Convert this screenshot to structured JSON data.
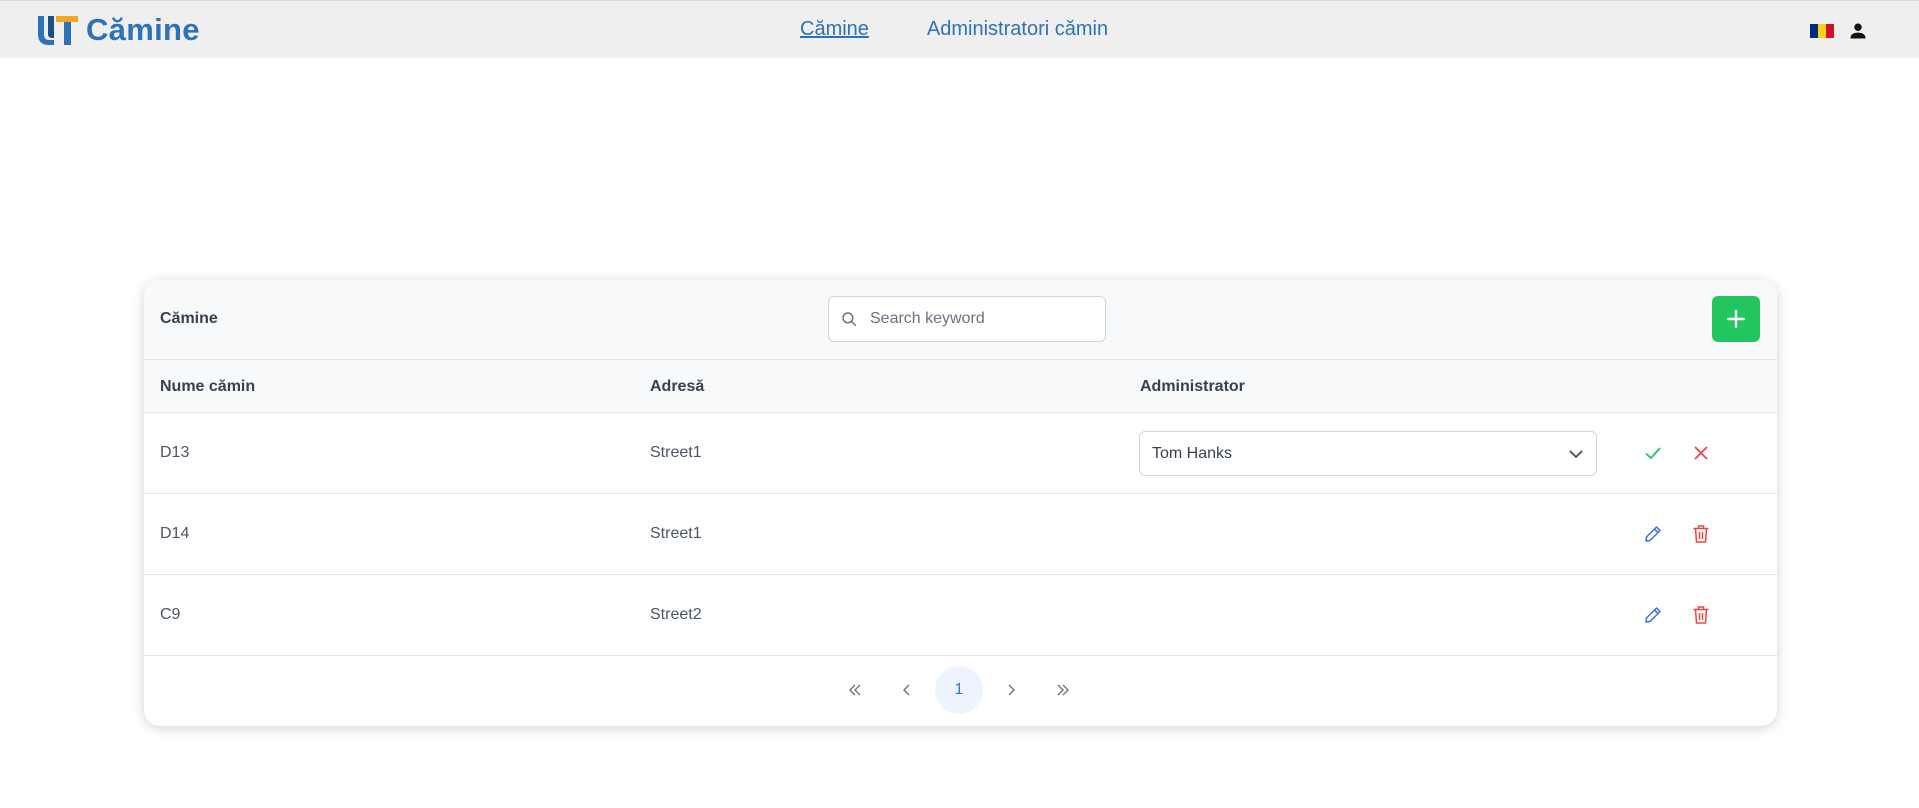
{
  "header": {
    "app_title": "Cămine",
    "nav": [
      {
        "label": "Cămine",
        "active": true
      },
      {
        "label": "Administratori cămin",
        "active": false
      }
    ],
    "flag_colors": [
      "#002b7f",
      "#fcd116",
      "#ce1126"
    ]
  },
  "card": {
    "title": "Cămine",
    "search_placeholder": "Search keyword",
    "add_icon": "plus-icon",
    "columns": [
      "Nume cămin",
      "Adresă",
      "Administrator"
    ],
    "rows": [
      {
        "name": "D13",
        "address": "Street1",
        "administrator": "Tom Hanks",
        "editing": true
      },
      {
        "name": "D14",
        "address": "Street1",
        "administrator": "",
        "editing": false
      },
      {
        "name": "C9",
        "address": "Street2",
        "administrator": "",
        "editing": false
      }
    ],
    "pagination": {
      "current_page": "1"
    }
  },
  "colors": {
    "brand": "#2d72b8",
    "add_button": "#22c55e",
    "confirm": "#22c55e",
    "cancel": "#ef4444",
    "edit": "#3b6fd8",
    "delete": "#ef4444"
  }
}
